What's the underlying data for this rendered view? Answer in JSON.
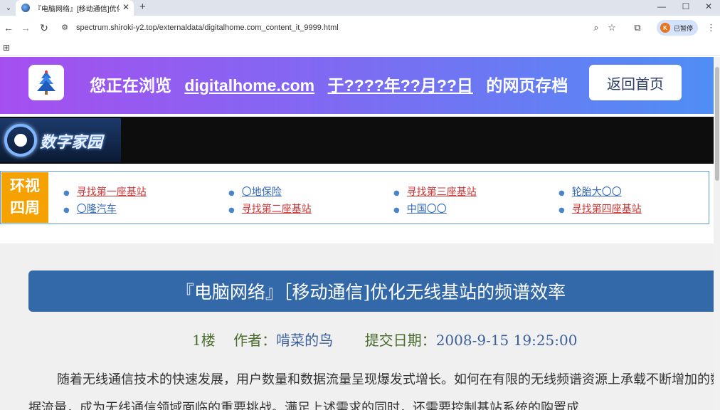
{
  "browser": {
    "tab_title": "『电脑网络』[移动通信]优化无",
    "url": "spectrum.shiroki-y2.top/externaldata/digitalhome.com_content_it_9999.html",
    "profile_initial": "K",
    "profile_label": "已暂停"
  },
  "archive_banner": {
    "prefix": "您正在浏览",
    "domain": "digitalhome.com",
    "date": "于????年??月??日",
    "suffix": "的网页存档",
    "home_button": "返回首页"
  },
  "site": {
    "logo_text": "数字家园"
  },
  "nav": {
    "label_line1": "环视",
    "label_line2": "四周",
    "columns": [
      [
        {
          "text": "寻找第一座基站",
          "color": "red"
        },
        {
          "text": "〇隆汽车",
          "color": "blue"
        }
      ],
      [
        {
          "text": "〇地保险",
          "color": "blue"
        },
        {
          "text": "寻找第二座基站",
          "color": "red"
        }
      ],
      [
        {
          "text": "寻找第三座基站",
          "color": "red"
        },
        {
          "text": "中国〇〇",
          "color": "blue"
        }
      ],
      [
        {
          "text": "轮胎大〇〇",
          "color": "blue"
        },
        {
          "text": "寻找第四座基站",
          "color": "red"
        }
      ]
    ]
  },
  "article": {
    "title": "『电脑网络』［移动通信]优化无线基站的频谱效率",
    "floor": "1楼",
    "author_label": "作者：",
    "author": "啃菜的鸟",
    "date_label": "提交日期：",
    "date": "2008-9-15 19:25:00",
    "paragraph": "随着无线通信技术的快速发展，用户数量和数据流量呈现爆发式增长。如何在有限的无线频谱资源上承载不断增加的数据流量，成为无线通信领域面临的重要挑战。满足上述需求的同时，还需要控制基站系统的购置成"
  }
}
